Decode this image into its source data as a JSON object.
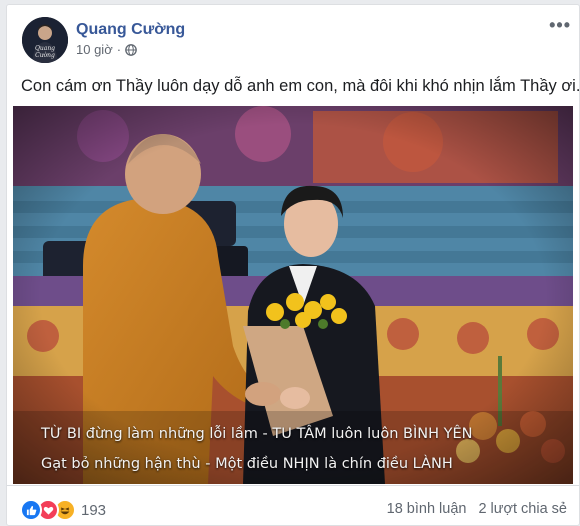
{
  "post": {
    "author": "Quang Cường",
    "time": "10 giờ",
    "separator": "·",
    "audience_icon": "globe-icon",
    "more_label": "•••",
    "caption": "Con cám ơn Thầy luôn dạy dỗ anh em con, mà đôi khi khó nhịn lắm Thầy ơi.",
    "avatar_text": "Quang Cường"
  },
  "photo": {
    "line1": "TỪ BI đừng làm những lỗi lầm - TU TÂM luôn luôn BÌNH YÊN",
    "line2": "Gạt bỏ những hận thù - Một điều NHỊN là chín điều LÀNH"
  },
  "footer": {
    "reaction_icons": [
      "like-icon",
      "love-icon",
      "haha-icon"
    ],
    "reaction_count": "193",
    "comments": "18 bình luận",
    "shares": "2 lượt chia sẻ"
  },
  "colors": {
    "author": "#385898",
    "like": "#1877f2",
    "love": "#f33e58",
    "haha": "#f7b125"
  }
}
